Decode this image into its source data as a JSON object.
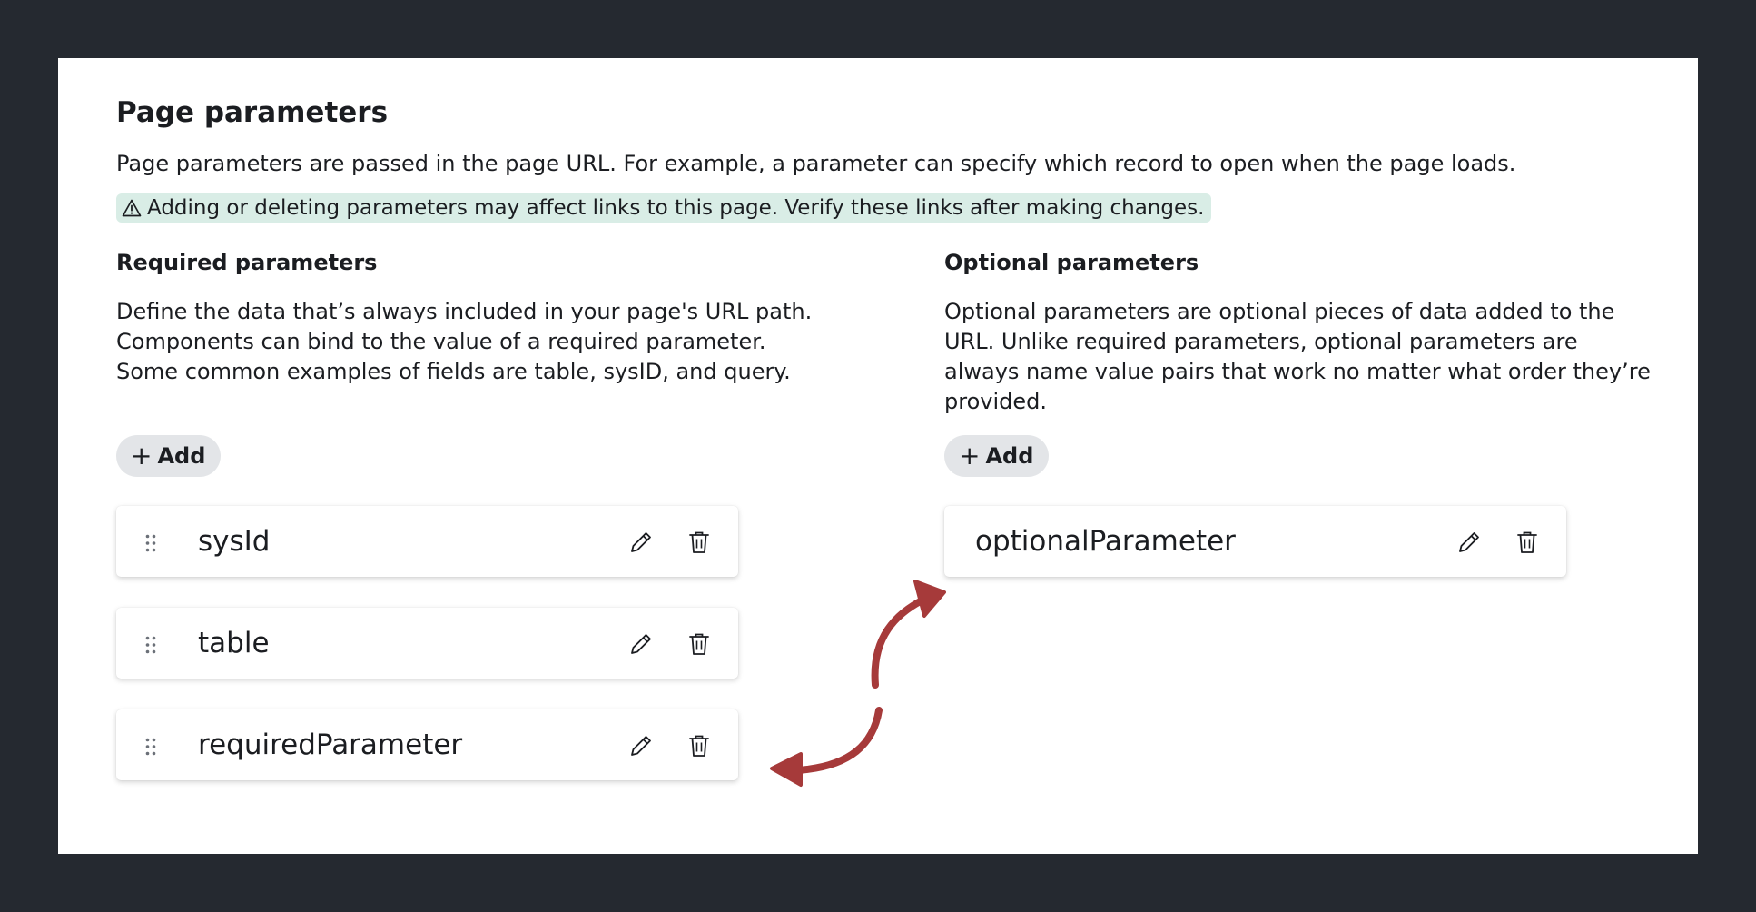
{
  "page": {
    "title": "Page parameters",
    "intro": "Page parameters are passed in the page URL. For example, a parameter can specify which record to open when the page loads.",
    "warning": "Adding or deleting parameters may affect links to this page. Verify these links after making changes."
  },
  "required": {
    "heading": "Required parameters",
    "description_lines": [
      "Define the data that’s always included in your page's URL path.",
      "Components can bind to the value of a required parameter.",
      "Some common examples of fields are table, sysID, and query."
    ],
    "add_label": "Add",
    "params": [
      {
        "name": "sysId"
      },
      {
        "name": "table"
      },
      {
        "name": "requiredParameter"
      }
    ]
  },
  "optional": {
    "heading": "Optional parameters",
    "description_lines": [
      "Optional parameters are optional pieces of data added to the",
      "URL. Unlike required parameters, optional parameters are",
      "always name value pairs that work no matter what order they’re",
      "provided."
    ],
    "add_label": "Add",
    "params": [
      {
        "name": "optionalParameter"
      }
    ]
  },
  "icons": {
    "warning": "warning-triangle-icon",
    "add": "plus-icon",
    "drag": "drag-handle-icon",
    "edit": "pencil-icon",
    "delete": "trash-icon",
    "annotation": "curved-arrow-icon"
  },
  "colors": {
    "background": "#252930",
    "panel": "#ffffff",
    "warning_bg": "#d9ede6",
    "add_button_bg": "#e3e5e8",
    "arrow": "#a63a3a"
  }
}
